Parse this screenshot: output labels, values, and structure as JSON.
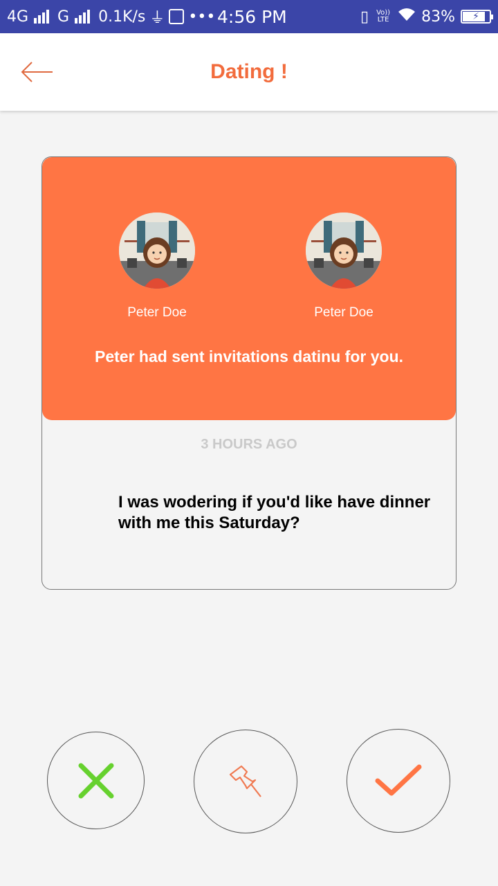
{
  "status_bar": {
    "network1": "4G",
    "network2": "G",
    "speed": "0.1K/s",
    "time": "4:56 PM",
    "volte": "Vo)) LTE",
    "battery": "83%",
    "battery_level": 0.83
  },
  "app_bar": {
    "title": "Dating !",
    "back_icon": "arrow-left-icon",
    "accent_color": "#f26c3d"
  },
  "card": {
    "header_color": "#ff7544",
    "persons": [
      {
        "name": "Peter Doe",
        "avatar": "girl-avatar"
      },
      {
        "name": "Peter Doe",
        "avatar": "girl-avatar"
      }
    ],
    "invite_text": "Peter had sent invitations datinu for you.",
    "time_ago": "3 HOURS AGO",
    "message": "I was wodering if you'd like have dinner with me this Saturday?"
  },
  "actions": {
    "reject_icon": "close-x-icon",
    "reject_color": "#66d12e",
    "pin_icon": "pushpin-icon",
    "accept_icon": "checkmark-icon",
    "accept_color": "#ff7544"
  }
}
